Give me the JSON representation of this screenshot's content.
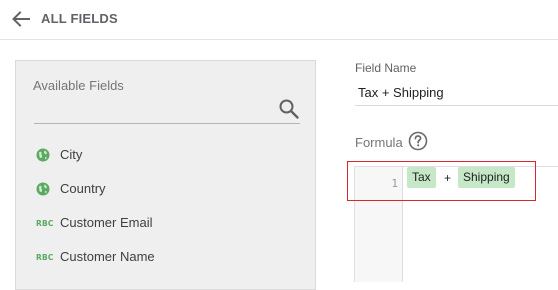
{
  "header": {
    "back_label": "ALL FIELDS"
  },
  "available_fields": {
    "heading": "Available Fields",
    "items": [
      {
        "label": "City",
        "icon": "globe-icon"
      },
      {
        "label": "Country",
        "icon": "globe-icon"
      },
      {
        "label": "Customer Email",
        "icon": "text-type-icon",
        "icon_text": "RBC"
      },
      {
        "label": "Customer Name",
        "icon": "text-type-icon",
        "icon_text": "RBC"
      }
    ]
  },
  "field_name": {
    "label": "Field Name",
    "value": "Tax + Shipping"
  },
  "formula": {
    "label": "Formula",
    "line_number": "1",
    "tokens": [
      {
        "type": "field",
        "text": "Tax"
      },
      {
        "type": "operator",
        "text": "+"
      },
      {
        "type": "field",
        "text": "Shipping"
      }
    ]
  },
  "colors": {
    "accent_green": "#5aaa62",
    "chip_green": "#c7e8c7",
    "highlight_red": "#d9272e"
  }
}
